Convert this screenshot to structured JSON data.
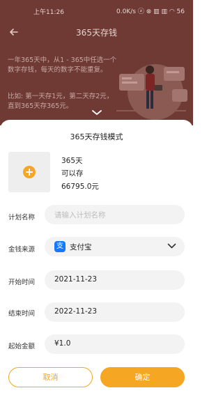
{
  "status_bar": {
    "time": "上午11:26",
    "right": "0.0K/s ⓩ ⊗ ▥ ▥ ◠ 56"
  },
  "nav": {
    "title": "365天存钱"
  },
  "description": {
    "paragraph1": "一年365天中，从1 - 365中任选一个数字存钱，每天的数字不能重复。",
    "paragraph2": "比如: 第一天存1元，第二天存2元，直到365天存365元。"
  },
  "sheet": {
    "title": "365天存钱模式",
    "summary": {
      "days": "365天",
      "can_save": "可以存",
      "amount": "66795.0元"
    },
    "form": {
      "plan_name": {
        "label": "计划名称",
        "placeholder": "请输入计划名称"
      },
      "money_source": {
        "label": "金钱来源",
        "value": "支付宝",
        "icon_glyph": "支"
      },
      "start_time": {
        "label": "开始时间",
        "value": "2021-11-23"
      },
      "end_time": {
        "label": "结束时间",
        "value": "2022-11-23"
      },
      "start_amount": {
        "label": "起始金额",
        "value": "¥1.0"
      }
    },
    "buttons": {
      "cancel": "取消",
      "confirm": "确定"
    }
  },
  "colors": {
    "accent": "#f5a623",
    "alipay": "#1677ff",
    "header_overlay": "#6e3a33"
  },
  "icons": [
    "back-arrow-icon",
    "chevron-down-icon",
    "add-icon",
    "alipay-icon",
    "dropdown-chevron-icon"
  ]
}
